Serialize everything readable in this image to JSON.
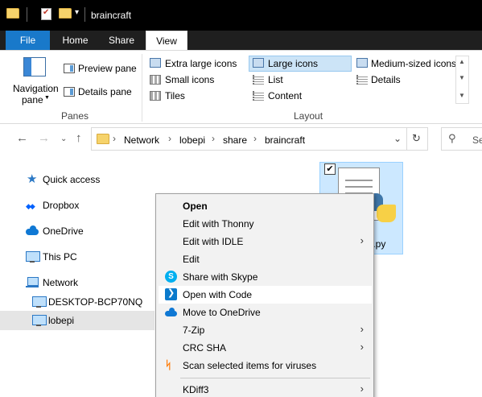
{
  "window": {
    "title": "braincraft"
  },
  "ribbon": {
    "tabs": {
      "file": "File",
      "home": "Home",
      "share": "Share",
      "view": "View"
    },
    "panes": {
      "navigation_pane": "Navigation",
      "navigation_pane_2": "pane",
      "preview_pane": "Preview pane",
      "details_pane": "Details pane",
      "group_label": "Panes"
    },
    "layout": {
      "extra_large_icons": "Extra large icons",
      "large_icons": "Large icons",
      "medium_icons": "Medium-sized icons",
      "small_icons": "Small icons",
      "list": "List",
      "details": "Details",
      "tiles": "Tiles",
      "content": "Content",
      "group_label": "Layout",
      "selected": "Large icons"
    }
  },
  "address": {
    "crumbs": [
      "Network",
      "lobepi",
      "share",
      "braincraft"
    ],
    "search_placeholder": "Se"
  },
  "navpane": {
    "items": [
      "Quick access",
      "Dropbox",
      "OneDrive",
      "This PC",
      "Network",
      "DESKTOP-BCP70NQ",
      "lobepi"
    ],
    "selected": "lobepi"
  },
  "file": {
    "name_visible": "t.py",
    "checked": "✔"
  },
  "context_menu": {
    "items": [
      {
        "label": "Open",
        "bold": true
      },
      {
        "label": "Edit with Thonny"
      },
      {
        "label": "Edit with IDLE",
        "submenu": true
      },
      {
        "label": "Edit"
      },
      {
        "label": "Share with Skype",
        "icon": "skype-icon"
      },
      {
        "label": "Open with Code",
        "icon": "vscode-icon",
        "highlighted": true
      },
      {
        "label": "Move to OneDrive",
        "icon": "onedrive-icon"
      },
      {
        "label": "7-Zip",
        "submenu": true
      },
      {
        "label": "CRC SHA",
        "submenu": true
      },
      {
        "label": "Scan selected items for viruses",
        "icon": "avast-icon"
      },
      {
        "label": "KDiff3",
        "submenu": true
      }
    ]
  },
  "colors": {
    "file_tab": "#1979ca",
    "selection": "#cce8ff",
    "menu_bg": "#f2f2f2"
  }
}
